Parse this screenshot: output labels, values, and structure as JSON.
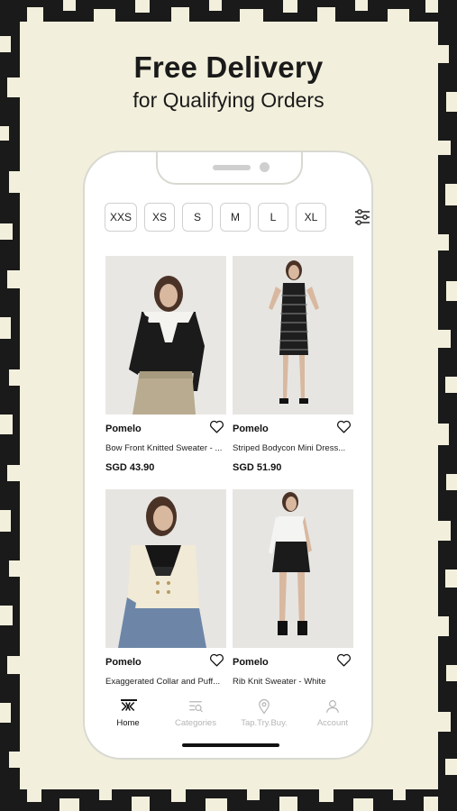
{
  "promo": {
    "title": "Free Delivery",
    "subtitle": "for Qualifying Orders"
  },
  "filters": {
    "sizes": [
      "XXS",
      "XS",
      "S",
      "M",
      "L",
      "XL"
    ],
    "filter_icon": "sliders-icon"
  },
  "products": [
    {
      "brand": "Pomelo",
      "name": "Bow Front Knitted Sweater - ...",
      "price": "SGD 43.90",
      "image": "model in black off-shoulder sweater with bow and beige skirt"
    },
    {
      "brand": "Pomelo",
      "name": "Striped Bodycon Mini Dress...",
      "price": "SGD 51.90",
      "image": "model in black striped bodycon mini dress"
    },
    {
      "brand": "Pomelo",
      "name": "Exaggerated Collar and Puff...",
      "price": "",
      "image": "model in cream cardigan with black collar and jeans"
    },
    {
      "brand": "Pomelo",
      "name": "Rib Knit Sweater - White",
      "price": "",
      "image": "model in white rib knit top and black skirt"
    }
  ],
  "nav": [
    {
      "label": "Home",
      "icon": "home-logo-icon",
      "active": true
    },
    {
      "label": "Categories",
      "icon": "categories-icon",
      "active": false
    },
    {
      "label": "Tap.Try.Buy.",
      "icon": "location-pin-icon",
      "active": false
    },
    {
      "label": "Account",
      "icon": "account-icon",
      "active": false
    }
  ],
  "colors": {
    "background": "#f2efdc",
    "pattern": "#1a1a1a",
    "text": "#1a1a1a",
    "inactive_nav": "#b5b5b5"
  }
}
